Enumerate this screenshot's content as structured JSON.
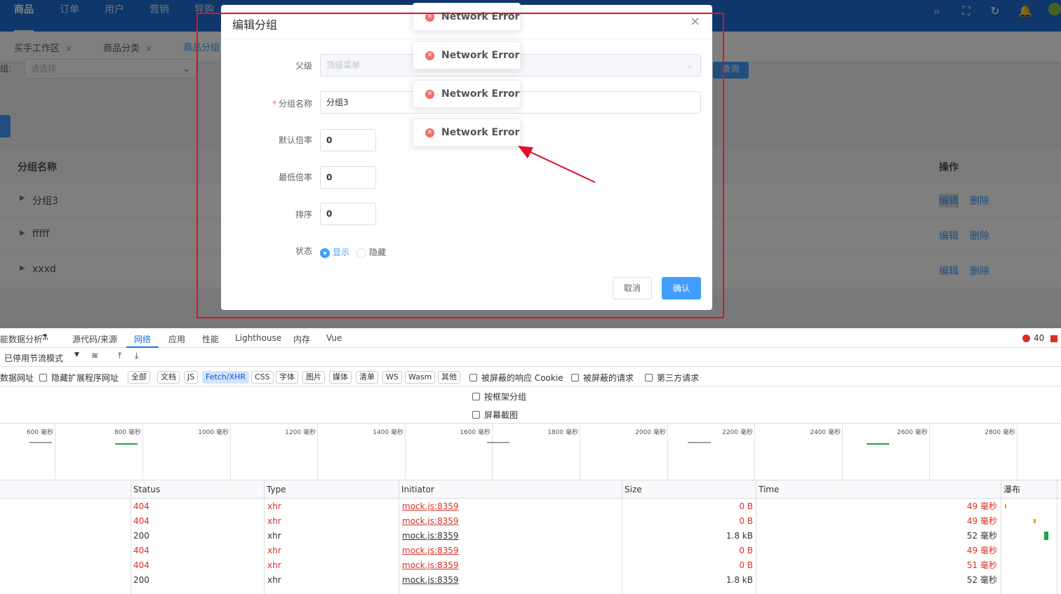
{
  "topnav": {
    "items": [
      "商品",
      "订单",
      "用户",
      "营销",
      "导购"
    ],
    "active_index": 0,
    "icons": [
      "search-icon",
      "fullscreen-icon",
      "refresh-icon",
      "bell-icon"
    ]
  },
  "tabs": [
    {
      "label": "买手工作区",
      "close": "×"
    },
    {
      "label": "商品分类",
      "close": "×"
    },
    {
      "label": "商品分组",
      "close": ""
    }
  ],
  "filter": {
    "label": "组:",
    "select_placeholder": "请选择",
    "query_button": "查询"
  },
  "table": {
    "headers": {
      "name": "分组名称",
      "actions": "操作"
    },
    "rows": [
      {
        "name": "分组3",
        "edit": "编辑",
        "delete": "删除"
      },
      {
        "name": "fffff",
        "edit": "编辑",
        "delete": "删除"
      },
      {
        "name": "xxxd",
        "edit": "编辑",
        "delete": "删除"
      }
    ]
  },
  "dialog": {
    "title": "编辑分组",
    "close": "×",
    "fields": {
      "parent_label": "父级",
      "parent_value": "顶级菜单",
      "name_label": "分组名称",
      "name_required_mark": "*",
      "name_value": "分组3",
      "default_rate_label": "默认倍率",
      "default_rate_value": "0",
      "min_rate_label": "最低倍率",
      "min_rate_value": "0",
      "sort_label": "排序",
      "sort_value": "0",
      "status_label": "状态",
      "status_show": "显示",
      "status_hide": "隐藏",
      "status_selected": "显示"
    },
    "cancel_button": "取消",
    "confirm_button": "确认"
  },
  "toasts": [
    "Network Error",
    "Network Error",
    "Network Error",
    "Network Error"
  ],
  "annotation": {
    "box_color": "#e0102a",
    "arrow_color": "#e0102a"
  },
  "devtools": {
    "tabs": [
      "能数据分析",
      "源代码/来源",
      "网络",
      "应用",
      "性能",
      "Lighthouse",
      "内存",
      "Vue"
    ],
    "active_tab": "网络",
    "error_count": "40",
    "throttle": "已停用节流模式",
    "filters": {
      "data_url": "数据网址",
      "hide_ext": "隐藏扩展程序网址",
      "types": [
        "全部",
        "文档",
        "JS",
        "Fetch/XHR",
        "CSS",
        "字体",
        "图片",
        "媒体",
        "清单",
        "WS",
        "Wasm",
        "其他"
      ],
      "active_type": "Fetch/XHR",
      "blocked_cookie": "被屏蔽的响应 Cookie",
      "blocked_req": "被屏蔽的请求",
      "third_party": "第三方请求"
    },
    "options": {
      "group_by_frame": "按框架分组",
      "screenshots": "屏幕截图"
    },
    "timeline_ticks": [
      "600 毫秒",
      "800 毫秒",
      "1000 毫秒",
      "1200 毫秒",
      "1400 毫秒",
      "1600 毫秒",
      "1800 毫秒",
      "2000 毫秒",
      "2200 毫秒",
      "2400 毫秒",
      "2600 毫秒",
      "2800 毫秒"
    ],
    "columns": {
      "status": "Status",
      "type": "Type",
      "initiator": "Initiator",
      "size": "Size",
      "time": "Time",
      "waterfall": "瀑布"
    },
    "rows": [
      {
        "status": "404",
        "type": "xhr",
        "initiator": "mock.js:8359",
        "size": "0 B",
        "time": "49 毫秒",
        "error": true
      },
      {
        "status": "404",
        "type": "xhr",
        "initiator": "mock.js:8359",
        "size": "0 B",
        "time": "49 毫秒",
        "error": true
      },
      {
        "status": "200",
        "type": "xhr",
        "initiator": "mock.js:8359",
        "size": "1.8 kB",
        "time": "52 毫秒",
        "error": false
      },
      {
        "status": "404",
        "type": "xhr",
        "initiator": "mock.js:8359",
        "size": "0 B",
        "time": "49 毫秒",
        "error": true
      },
      {
        "status": "404",
        "type": "xhr",
        "initiator": "mock.js:8359",
        "size": "0 B",
        "time": "51 毫秒",
        "error": true
      },
      {
        "status": "200",
        "type": "xhr",
        "initiator": "mock.js:8359",
        "size": "1.8 kB",
        "time": "52 毫秒",
        "error": false
      }
    ]
  }
}
